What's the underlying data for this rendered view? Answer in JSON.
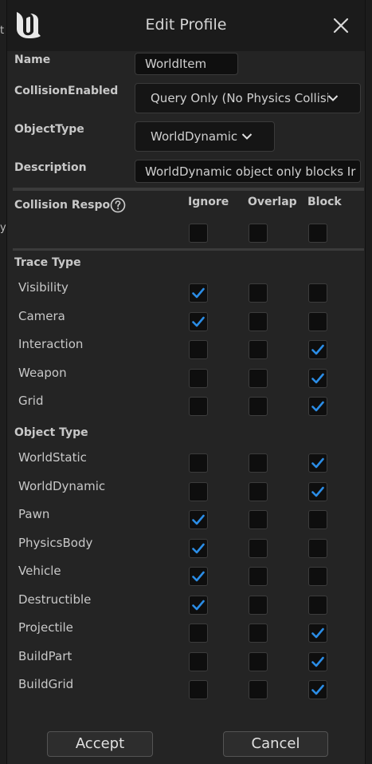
{
  "background": {
    "left_glyph_1": "t",
    "left_glyph_2": "y"
  },
  "dialog": {
    "title": "Edit Profile",
    "name": {
      "label": "Name",
      "value": "WorldItem"
    },
    "collision_enabled": {
      "label": "CollisionEnabled",
      "value": "Query Only (No Physics Collisi"
    },
    "object_type": {
      "label": "ObjectType",
      "value": "WorldDynamic"
    },
    "description": {
      "label": "Description",
      "value": "WorldDynamic object only blocks Ir"
    },
    "responses": {
      "label": "Collision Respo",
      "columns": [
        "Ignore",
        "Overlap",
        "Block"
      ],
      "all_row": {
        "ignore": false,
        "overlap": false,
        "block": false
      },
      "trace_type": {
        "label": "Trace Type",
        "rows": [
          {
            "name": "Visibility",
            "response": "Ignore"
          },
          {
            "name": "Camera",
            "response": "Ignore"
          },
          {
            "name": "Interaction",
            "response": "Block"
          },
          {
            "name": "Weapon",
            "response": "Block"
          },
          {
            "name": "Grid",
            "response": "Block"
          }
        ]
      },
      "object_type": {
        "label": "Object Type",
        "rows": [
          {
            "name": "WorldStatic",
            "response": "Block"
          },
          {
            "name": "WorldDynamic",
            "response": "Block"
          },
          {
            "name": "Pawn",
            "response": "Ignore"
          },
          {
            "name": "PhysicsBody",
            "response": "Ignore"
          },
          {
            "name": "Vehicle",
            "response": "Ignore"
          },
          {
            "name": "Destructible",
            "response": "Ignore"
          },
          {
            "name": "Projectile",
            "response": "Block"
          },
          {
            "name": "BuildPart",
            "response": "Block"
          },
          {
            "name": "BuildGrid",
            "response": "Block"
          }
        ]
      }
    },
    "buttons": {
      "accept": "Accept",
      "cancel": "Cancel"
    }
  },
  "colors": {
    "accent": "#2b8de6",
    "panel": "#242424",
    "titlebar": "#1b1b1b"
  }
}
